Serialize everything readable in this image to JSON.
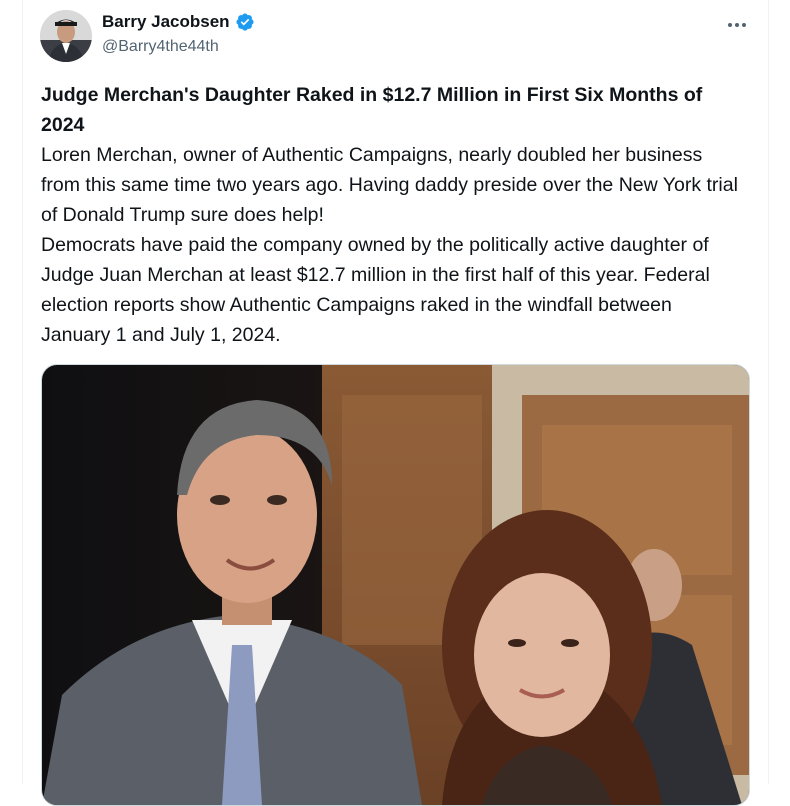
{
  "tweet": {
    "author": {
      "display_name": "Barry Jacobsen",
      "handle": "@Barry4the44th",
      "verified": true,
      "avatar_icon": "user-avatar"
    },
    "more_icon": "more-horizontal-icon",
    "headline": "Judge Merchan's Daughter Raked in $12.7 Million in First Six Months of 2024",
    "paragraphs": [
      "Loren Merchan, owner of Authentic Campaigns, nearly doubled her business from this same time two years ago. Having daddy preside over the New York trial of Donald Trump sure does help!",
      "Democrats have paid the company owned by the politically active daughter of Judge Juan Merchan at least $12.7 million in the first half of this year. Federal election reports show Authentic Campaigns raked in the windfall between January 1 and July 1, 2024."
    ],
    "media": {
      "type": "photo"
    }
  },
  "colors": {
    "text_primary": "#0f1419",
    "text_secondary": "#536471",
    "verified_badge": "#1d9bf0",
    "border": "#cfd9de"
  }
}
